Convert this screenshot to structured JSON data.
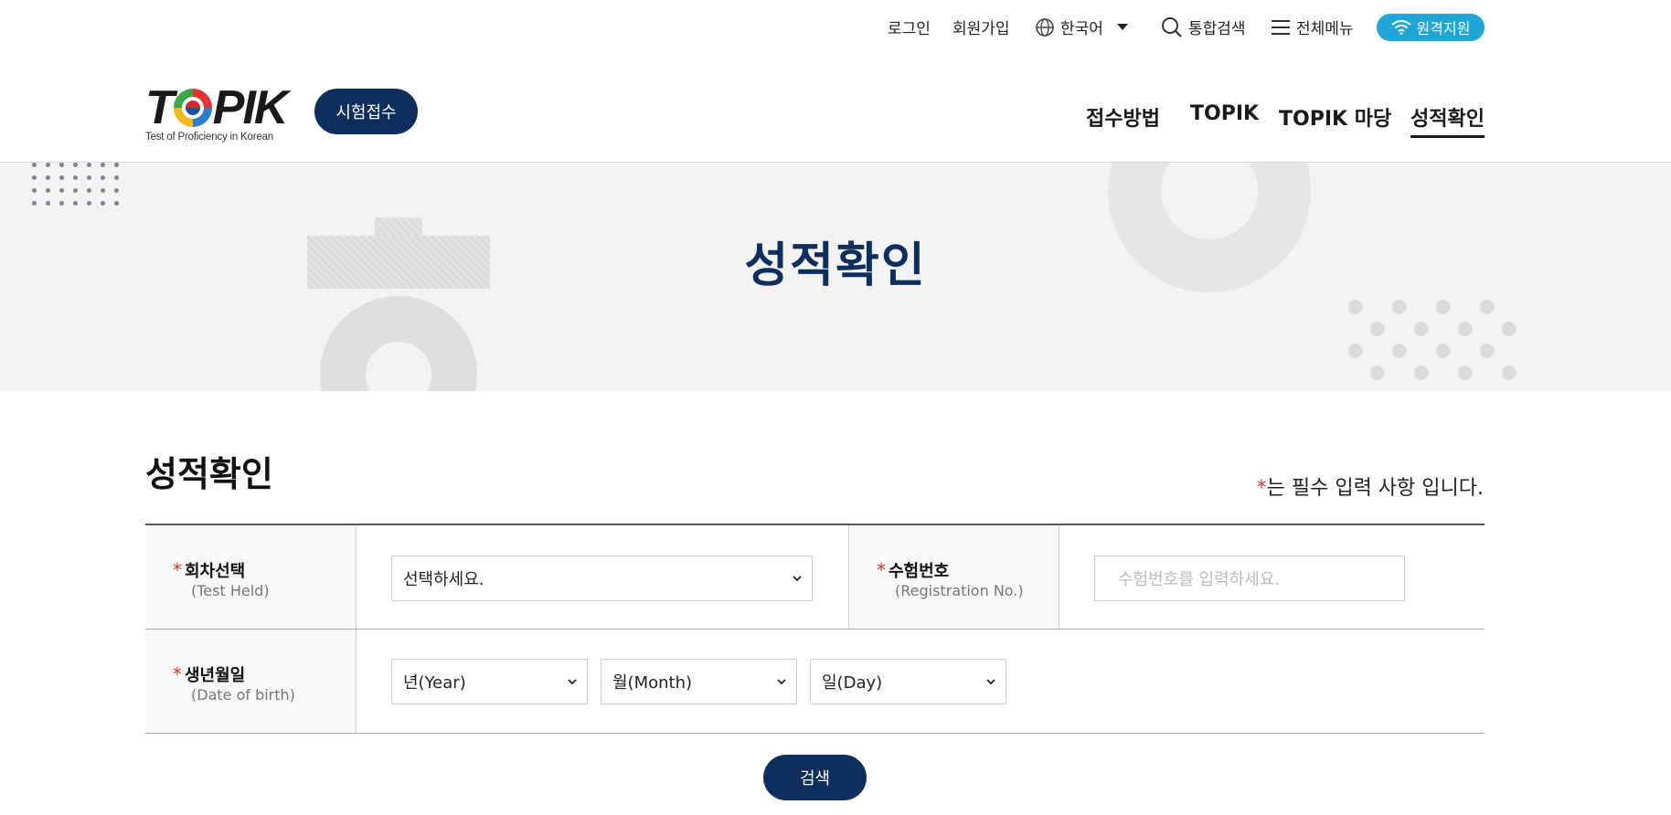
{
  "utility": {
    "login": "로그인",
    "signup": "회원가입",
    "language": "한국어",
    "search": "통합검색",
    "all_menu": "전체메뉴",
    "remote_support": "원격지원"
  },
  "header": {
    "logo_text_left": "T",
    "logo_text_right": "PIK",
    "logo_subtitle": "Test of Proficiency in Korean",
    "apply_button": "시험접수",
    "nav": [
      "접수방법",
      "TOPIK",
      "TOPIK 마당",
      "성적확인"
    ],
    "active_nav": "성적확인"
  },
  "banner": {
    "title": "성적확인"
  },
  "content": {
    "section_title": "성적확인",
    "required_mark": "*",
    "required_note": "는 필수 입력 사항 입니다.",
    "fields": {
      "test_held": {
        "label": "회차선택",
        "sub": "(Test Held)",
        "selected": "선택하세요."
      },
      "registration_no": {
        "label": "수험번호",
        "sub": "(Registration No.)",
        "placeholder": "수험번호를 입력하세요."
      },
      "birth": {
        "label": "생년월일",
        "sub": "(Date of birth)",
        "year": "년(Year)",
        "month": "월(Month)",
        "day": "일(Day)"
      }
    },
    "search_button": "검색"
  },
  "colors": {
    "navy": "#0e2f5e",
    "remote_blue": "#1fa6d8",
    "required_red": "#e03a2a",
    "banner_bg": "#f3f3f3",
    "title_highlight": "#b8d6ee"
  }
}
